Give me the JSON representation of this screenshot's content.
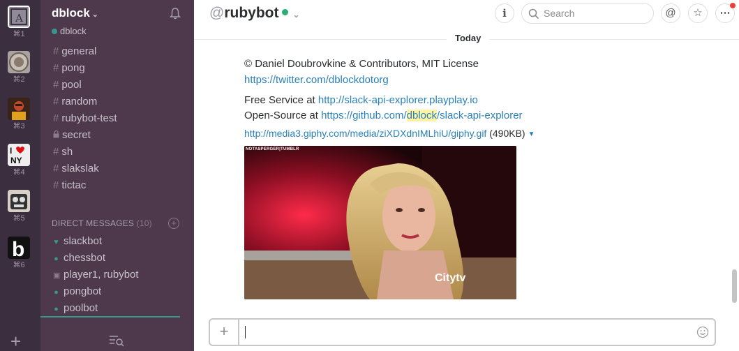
{
  "teams": [
    {
      "key": "⌘1"
    },
    {
      "key": "⌘2"
    },
    {
      "key": "⌘3"
    },
    {
      "key": "⌘4"
    },
    {
      "key": "⌘5"
    },
    {
      "key": "⌘6"
    }
  ],
  "team_add": "+",
  "sidebar": {
    "team_name": "dblock",
    "user": "dblock",
    "channels": [
      "general",
      "pong",
      "pool",
      "random",
      "rubybot-test",
      "secret",
      "sh",
      "slakslak",
      "tictac"
    ],
    "dm_header": "DIRECT MESSAGES",
    "dm_count": "(10)",
    "dms": [
      "slackbot",
      "chessbot",
      "player1, rubybot",
      "pongbot",
      "poolbot"
    ]
  },
  "header": {
    "at": "@",
    "channel": "rubybot",
    "search_placeholder": "Search"
  },
  "day_label": "Today",
  "messages": {
    "copyright": "© Daniel Doubrovkine & Contributors, MIT License",
    "twitter": "https://twitter.com/dblockdotorg",
    "free_prefix": "Free Service at ",
    "free_link": "http://slack-api-explorer.playplay.io",
    "open_prefix": "Open-Source at ",
    "open_link_a": "https://github.com/",
    "open_link_hl": "dblock",
    "open_link_b": "/slack-api-explorer",
    "file_link": "http://media3.giphy.com/media/ziXDXdnIMLhiU/giphy.gif",
    "file_size": " (490KB)"
  },
  "gif": {
    "tag": "NOTASPERGER|TUMBLR",
    "logo": "Citytv"
  },
  "colors": {
    "team_bg": "#3b2e3f",
    "sidebar_bg": "#4d394b",
    "accent": "#38978d",
    "link": "#2a80b9",
    "presence": "#2bac76"
  }
}
